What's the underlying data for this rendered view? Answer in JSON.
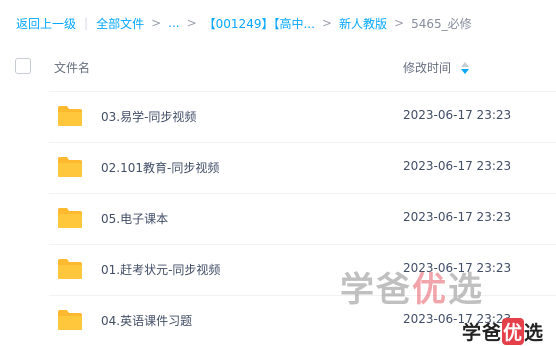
{
  "breadcrumb": {
    "back": "返回上一级",
    "items": [
      "全部文件",
      "...",
      "【001249】【高中...",
      "新人教版",
      "5465_必修"
    ]
  },
  "table": {
    "headers": {
      "name": "文件名",
      "modified": "修改时间"
    },
    "rows": [
      {
        "name": "03.易学-同步视频",
        "modified": "2023-06-17 23:23",
        "icon": "folder-icon"
      },
      {
        "name": "02.101教育-同步视频",
        "modified": "2023-06-17 23:23",
        "icon": "folder-icon"
      },
      {
        "name": "05.电子课本",
        "modified": "2023-06-17 23:23",
        "icon": "folder-icon"
      },
      {
        "name": "01.赶考状元-同步视频",
        "modified": "2023-06-17 23:23",
        "icon": "folder-icon"
      },
      {
        "name": "04.英语课件习题",
        "modified": "2023-06-17 23:23",
        "icon": "folder-icon"
      }
    ]
  },
  "watermark": {
    "part1": "学爸",
    "part2": "优",
    "part3": "选"
  },
  "colors": {
    "accent": "#06a7ff",
    "folder": "#ffc83c",
    "text": "#424e67"
  }
}
